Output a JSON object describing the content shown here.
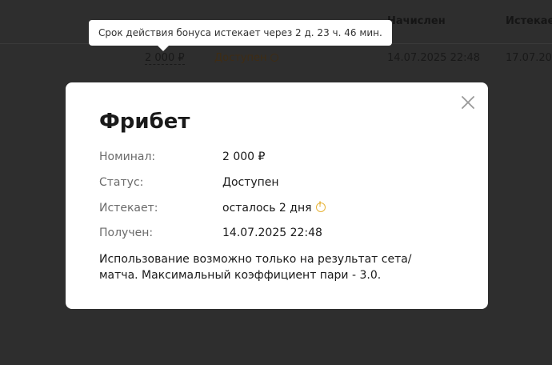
{
  "background_table": {
    "headers": {
      "col_issued": "Начислен",
      "col_expires": "Истекае"
    },
    "row": {
      "amount": "2 000 ₽",
      "status": "Доступен",
      "issued": "14.07.2025 22:48",
      "expires": "17.07.202"
    }
  },
  "tooltip": {
    "text": "Срок действия бонуса истекает через 2 д. 23 ч. 46 мин."
  },
  "modal": {
    "title": "Фрибет",
    "rows": [
      {
        "label": "Номинал:",
        "value": "2 000 ₽"
      },
      {
        "label": "Статус:",
        "value": "Доступен"
      },
      {
        "label": "Истекает:",
        "value": "осталось 2 дня"
      },
      {
        "label": "Получен:",
        "value": "14.07.2025 22:48"
      }
    ],
    "description": "Использование возможно только на результат сета/ матча. Максимальный коэффициент пари - 3.0."
  },
  "colors": {
    "backdrop": "#2e2e2e",
    "warning": "#e7b43a"
  },
  "icons": [
    "close-icon",
    "warning-icon"
  ]
}
